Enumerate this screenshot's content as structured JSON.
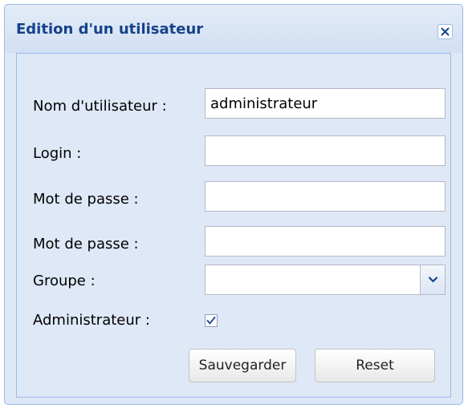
{
  "window": {
    "title": "Edition d'un utilisateur"
  },
  "form": {
    "username_label": "Nom d'utilisateur :",
    "username_value": "administrateur",
    "login_label": "Login :",
    "login_value": "",
    "password_label": "Mot de passe :",
    "password_value": "",
    "password_confirm_label": "Mot de passe :",
    "password_confirm_value": "",
    "group_label": "Groupe :",
    "group_value": "",
    "admin_label": "Administrateur :",
    "admin_checked": true
  },
  "buttons": {
    "save_label": "Sauvegarder",
    "reset_label": "Reset"
  },
  "colors": {
    "title_text": "#15428b",
    "panel_background": "#dfe8f6",
    "border": "#99bbe8"
  }
}
